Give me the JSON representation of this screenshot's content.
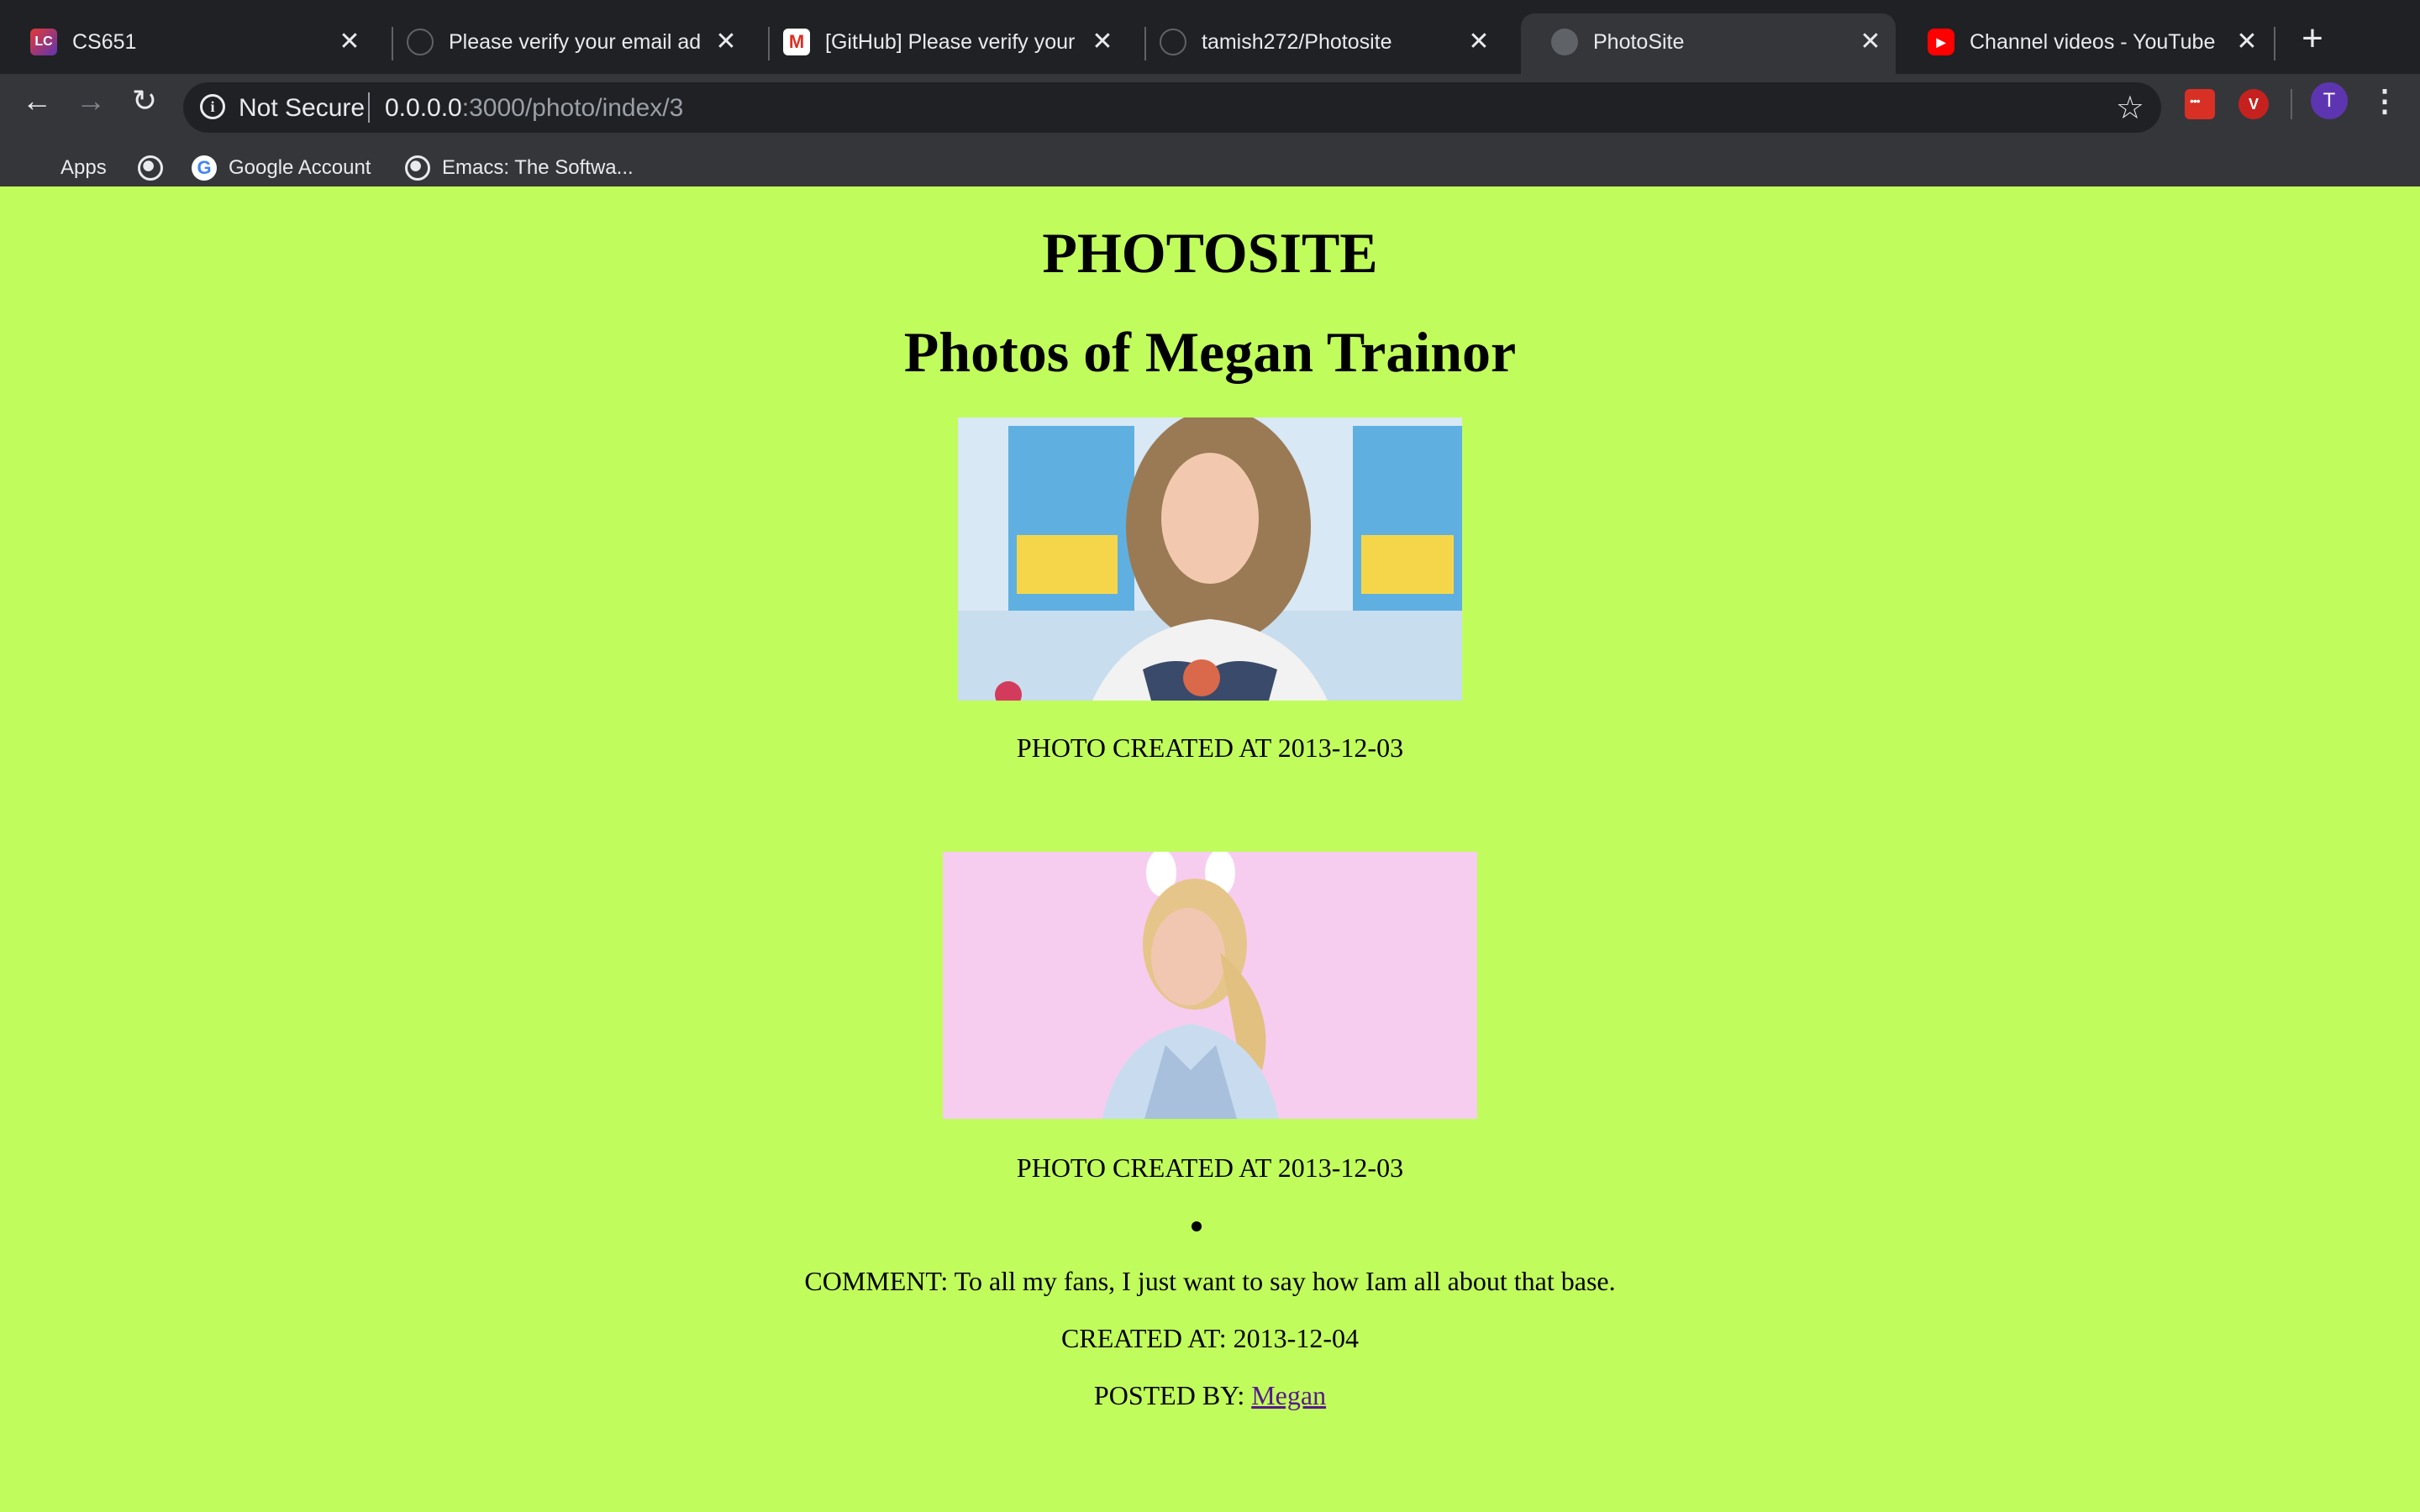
{
  "browser": {
    "tabs": [
      {
        "title": "CS651",
        "icon": "lc-icon",
        "active": false
      },
      {
        "title": "Please verify your email addre",
        "icon": "github-icon",
        "active": false
      },
      {
        "title": "[GitHub] Please verify your em",
        "icon": "gmail-icon",
        "active": false
      },
      {
        "title": "tamish272/Photosite",
        "icon": "github-icon",
        "active": false
      },
      {
        "title": "PhotoSite",
        "icon": "globe-icon",
        "active": true
      },
      {
        "title": "Channel videos - YouTube Stu",
        "icon": "youtube-icon",
        "active": false
      }
    ],
    "address": {
      "security": "Not Secure",
      "host": "0.0.0.0",
      "rest": ":3000/photo/index/3"
    },
    "avatar_letter": "T",
    "bookmarks": [
      {
        "label": "Apps",
        "icon": "apps-grid-icon"
      },
      {
        "label": "",
        "icon": "globe-icon"
      },
      {
        "label": "Google Account",
        "icon": "google-icon"
      },
      {
        "label": "Emacs: The Softwa...",
        "icon": "globe-icon"
      }
    ]
  },
  "page": {
    "site_title": "PHOTOSITE",
    "gallery_title": "Photos of Megan Trainor",
    "photos": [
      {
        "caption": "PHOTO CREATED AT 2013-12-03"
      },
      {
        "caption": "PHOTO CREATED AT 2013-12-03"
      }
    ],
    "comment": {
      "text": "COMMENT: To all my fans, I just want to say how Iam all about that base.",
      "created": "CREATED AT: 2013-12-04",
      "posted_by_label": "POSTED BY: ",
      "author": "Megan"
    }
  },
  "colors": {
    "page_background": "#c1fc5d",
    "chrome_dark": "#202124",
    "chrome_toolbar": "#35363a",
    "link_visited": "#551a8b"
  }
}
